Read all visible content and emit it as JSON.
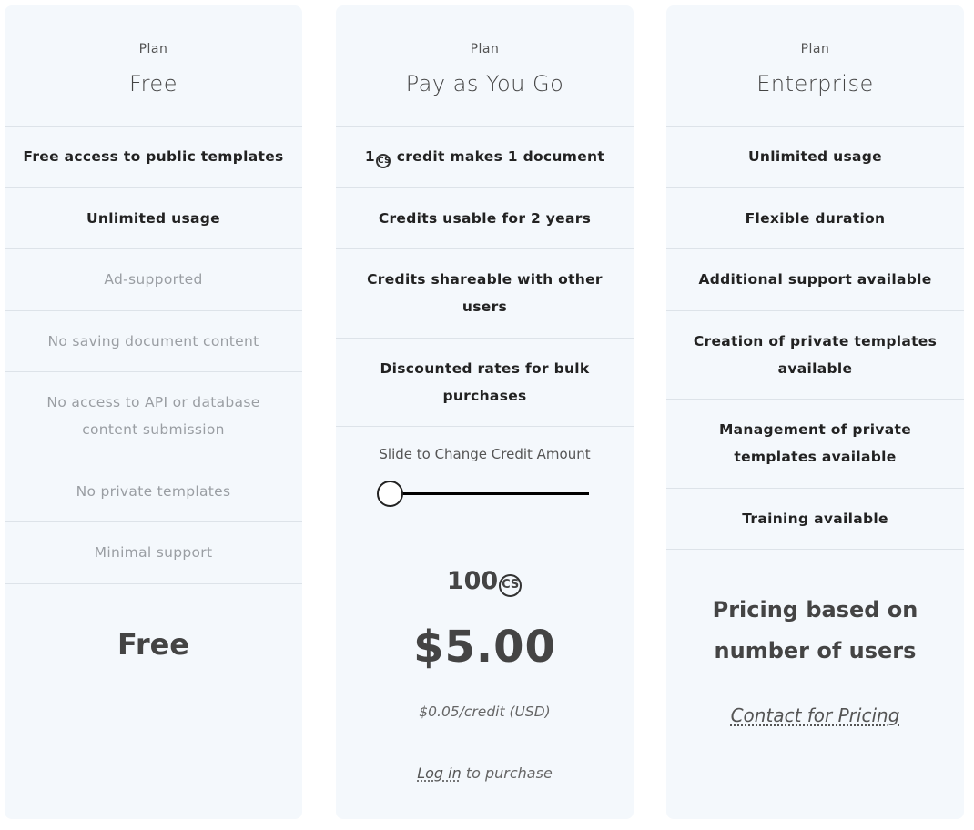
{
  "columns": [
    {
      "plan_label": "Plan",
      "plan_name": "Free",
      "features": [
        "Free access to public templates",
        "Unlimited usage",
        "Ad-supported",
        "No saving document content",
        "No access to API or database content submission",
        "No private templates",
        "Minimal support"
      ],
      "price": "Free"
    },
    {
      "plan_label": "Plan",
      "plan_name": "Pay as You Go",
      "features": [
        {
          "pre": "1",
          "post": " credit makes 1 document"
        },
        "Credits usable for 2 years",
        "Credits shareable with other users",
        "Discounted rates for bulk purchases"
      ],
      "slider_label": "Slide to Change Credit Amount",
      "slider_value": 100,
      "credits": "100",
      "price": "$5.00",
      "rate": "$0.05/credit (USD)",
      "login_link": "Log in",
      "purchase_suffix": " to purchase"
    },
    {
      "plan_label": "Plan",
      "plan_name": "Enterprise",
      "features": [
        "Unlimited usage",
        "Flexible duration",
        "Additional support available",
        "Creation of private templates available",
        "Management of private templates available",
        "Training available"
      ],
      "price": "Pricing based on number of users",
      "contact_link": "Contact for Pricing"
    }
  ],
  "icons": {
    "credit": "credit-coin-icon",
    "coin_text": "CS"
  }
}
